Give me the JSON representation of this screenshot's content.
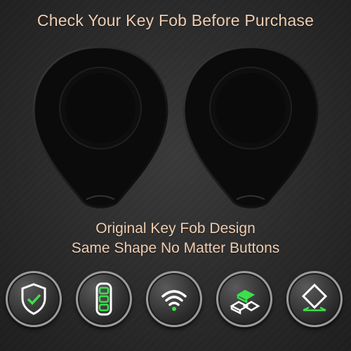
{
  "headline": "Check Your Key Fob Before Purchase",
  "fobs": [
    {
      "name": "key-fob-left"
    },
    {
      "name": "key-fob-right"
    }
  ],
  "subtitle": {
    "line1": "Original Key Fob Design",
    "line2": "Same Shape No Matter Buttons"
  },
  "badges": [
    {
      "icon": "shield-check-icon"
    },
    {
      "icon": "remote-key-icon"
    },
    {
      "icon": "wifi-signal-icon"
    },
    {
      "icon": "gold-bars-icon"
    },
    {
      "icon": "diamond-icon"
    }
  ],
  "colors": {
    "text": "#f0cdb0",
    "accent": "#3be04a",
    "icon_line": "#ffffff"
  }
}
